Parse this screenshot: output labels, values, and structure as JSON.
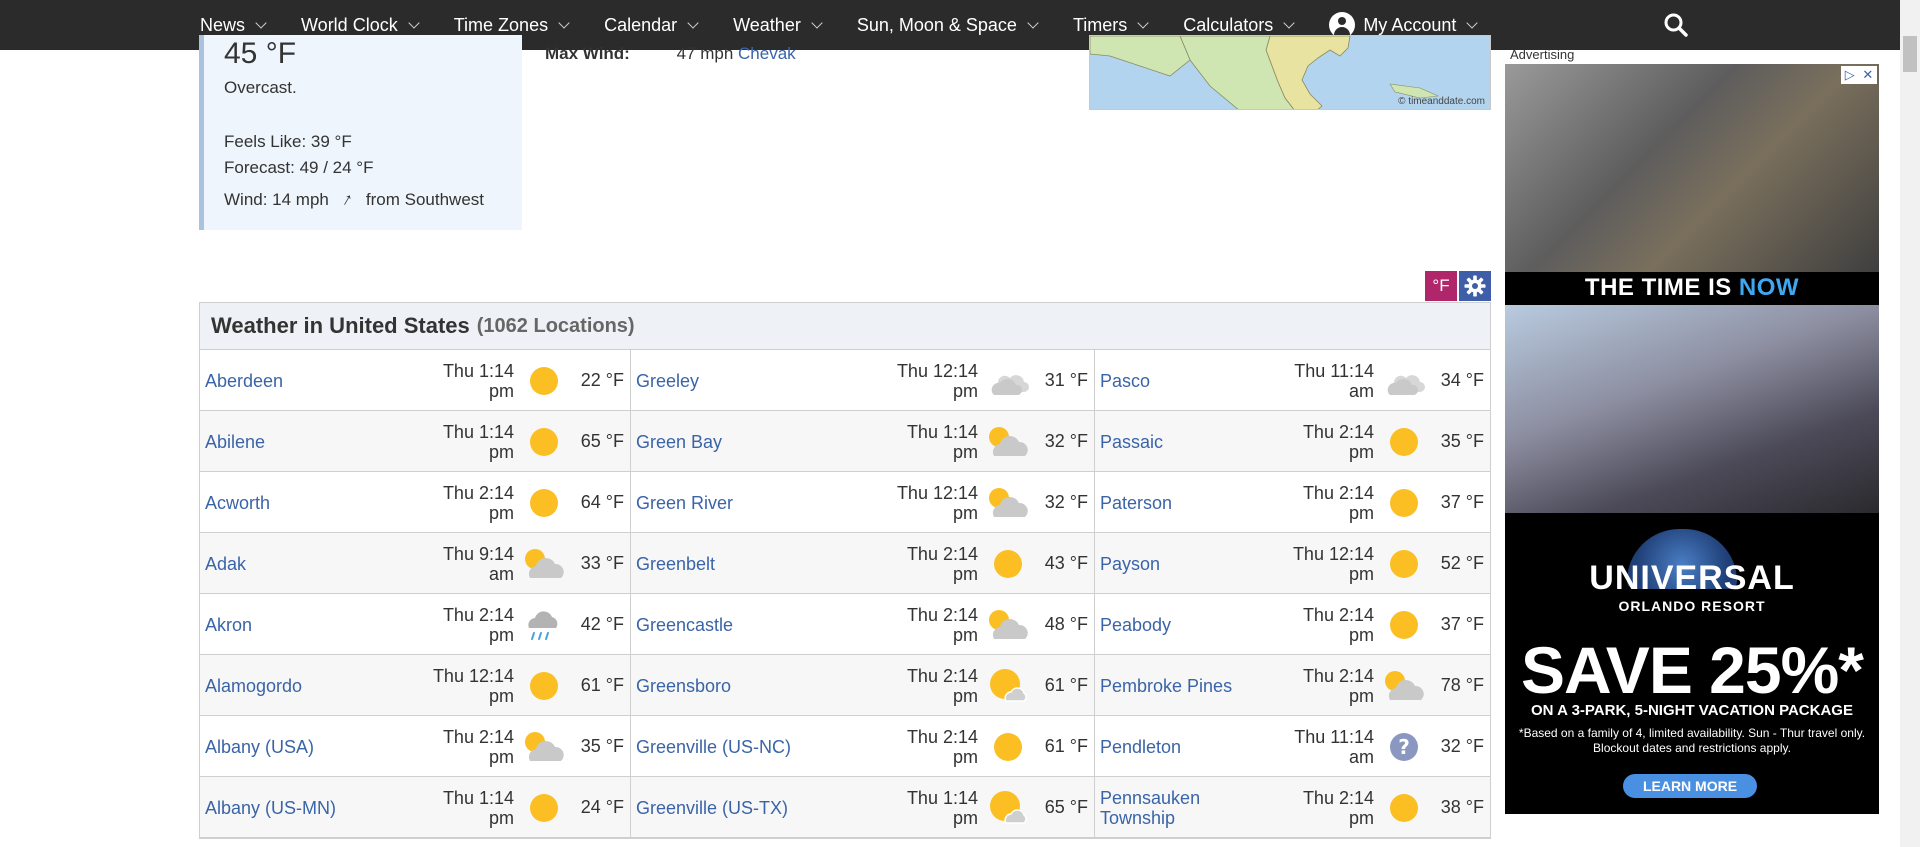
{
  "nav": {
    "items": [
      {
        "label": "News"
      },
      {
        "label": "World Clock"
      },
      {
        "label": "Time Zones"
      },
      {
        "label": "Calendar"
      },
      {
        "label": "Weather"
      },
      {
        "label": "Sun, Moon & Space"
      },
      {
        "label": "Timers"
      },
      {
        "label": "Calculators"
      }
    ],
    "account_label": "My Account"
  },
  "current": {
    "temp": "45 °F",
    "desc": "Overcast.",
    "feels": "Feels Like: 39 °F",
    "forecast": "Forecast: 49 / 24 °F",
    "wind_prefix": "Wind: 14 mph",
    "wind_suffix": "from Southwest",
    "maxwind_label": "Max Wind:",
    "maxwind_value": "47 mph",
    "maxwind_place": "Chevak"
  },
  "map": {
    "credit": "© timeanddate.com"
  },
  "units": {
    "label": "°F"
  },
  "table": {
    "title": "Weather in United States",
    "count": "(1062 Locations)",
    "rows": [
      [
        {
          "city": "Aberdeen",
          "time1": "Thu 1:14",
          "time2": "pm",
          "icon": "sunny",
          "temp": "22 °F"
        },
        {
          "city": "Greeley",
          "time1": "Thu 12:14",
          "time2": "pm",
          "icon": "cloudy",
          "temp": "31 °F"
        },
        {
          "city": "Pasco",
          "time1": "Thu 11:14",
          "time2": "am",
          "icon": "cloudy",
          "temp": "34 °F"
        }
      ],
      [
        {
          "city": "Abilene",
          "time1": "Thu 1:14",
          "time2": "pm",
          "icon": "sunny",
          "temp": "65 °F"
        },
        {
          "city": "Green Bay",
          "time1": "Thu 1:14",
          "time2": "pm",
          "icon": "partly-cloudy",
          "temp": "32 °F"
        },
        {
          "city": "Passaic",
          "time1": "Thu 2:14",
          "time2": "pm",
          "icon": "sunny",
          "temp": "35 °F"
        }
      ],
      [
        {
          "city": "Acworth",
          "time1": "Thu 2:14",
          "time2": "pm",
          "icon": "sunny",
          "temp": "64 °F"
        },
        {
          "city": "Green River",
          "time1": "Thu 12:14",
          "time2": "pm",
          "icon": "partly-cloudy",
          "temp": "32 °F"
        },
        {
          "city": "Paterson",
          "time1": "Thu 2:14",
          "time2": "pm",
          "icon": "sunny",
          "temp": "37 °F"
        }
      ],
      [
        {
          "city": "Adak",
          "time1": "Thu 9:14",
          "time2": "am",
          "icon": "partly-cloudy",
          "temp": "33 °F"
        },
        {
          "city": "Greenbelt",
          "time1": "Thu 2:14",
          "time2": "pm",
          "icon": "sunny",
          "temp": "43 °F"
        },
        {
          "city": "Payson",
          "time1": "Thu 12:14",
          "time2": "pm",
          "icon": "sunny",
          "temp": "52 °F"
        }
      ],
      [
        {
          "city": "Akron",
          "time1": "Thu 2:14",
          "time2": "pm",
          "icon": "rain",
          "temp": "42 °F"
        },
        {
          "city": "Greencastle",
          "time1": "Thu 2:14",
          "time2": "pm",
          "icon": "partly-cloudy",
          "temp": "48 °F"
        },
        {
          "city": "Peabody",
          "time1": "Thu 2:14",
          "time2": "pm",
          "icon": "sunny",
          "temp": "37 °F"
        }
      ],
      [
        {
          "city": "Alamogordo",
          "time1": "Thu 12:14",
          "time2": "pm",
          "icon": "sunny",
          "temp": "61 °F"
        },
        {
          "city": "Greensboro",
          "time1": "Thu 2:14",
          "time2": "pm",
          "icon": "sun-cloud",
          "temp": "61 °F"
        },
        {
          "city": "Pembroke Pines",
          "time1": "Thu 2:14",
          "time2": "pm",
          "icon": "partly-cloudy",
          "temp": "78 °F"
        }
      ],
      [
        {
          "city": "Albany (USA)",
          "time1": "Thu 2:14",
          "time2": "pm",
          "icon": "partly-cloudy",
          "temp": "35 °F"
        },
        {
          "city": "Greenville (US-NC)",
          "time1": "Thu 2:14",
          "time2": "pm",
          "icon": "sunny",
          "temp": "61 °F"
        },
        {
          "city": "Pendleton",
          "time1": "Thu 11:14",
          "time2": "am",
          "icon": "unknown",
          "temp": "32 °F"
        }
      ],
      [
        {
          "city": "Albany (US-MN)",
          "time1": "Thu 1:14",
          "time2": "pm",
          "icon": "sunny",
          "temp": "24 °F"
        },
        {
          "city": "Greenville (US-TX)",
          "time1": "Thu 1:14",
          "time2": "pm",
          "icon": "sun-cloud",
          "temp": "65 °F"
        },
        {
          "city": "Pennsauken Township",
          "time1": "Thu 2:14",
          "time2": "pm",
          "icon": "sunny",
          "temp": "38 °F"
        }
      ]
    ]
  },
  "ad": {
    "label": "Advertising",
    "tagline_a": "THE TIME IS ",
    "tagline_b": "NOW",
    "brand": "UNIVERSAL",
    "brand_sub": "ORLANDO RESORT",
    "save": "SAVE 25%*",
    "offer": "ON A 3-PARK, 5-NIGHT VACATION PACKAGE",
    "fine1": "*Based on a family of 4, limited availability. Sun - Thur travel only.",
    "fine2": "Blockout dates and restrictions apply.",
    "cta": "LEARN MORE"
  },
  "colors": {
    "sun": "#fbbf24",
    "cloud": "#c9c9c9",
    "link": "#3a64a8",
    "nav_bg": "#2b2b2b",
    "unit_btn": "#b0266a",
    "settings_btn": "#3f5ea9"
  }
}
